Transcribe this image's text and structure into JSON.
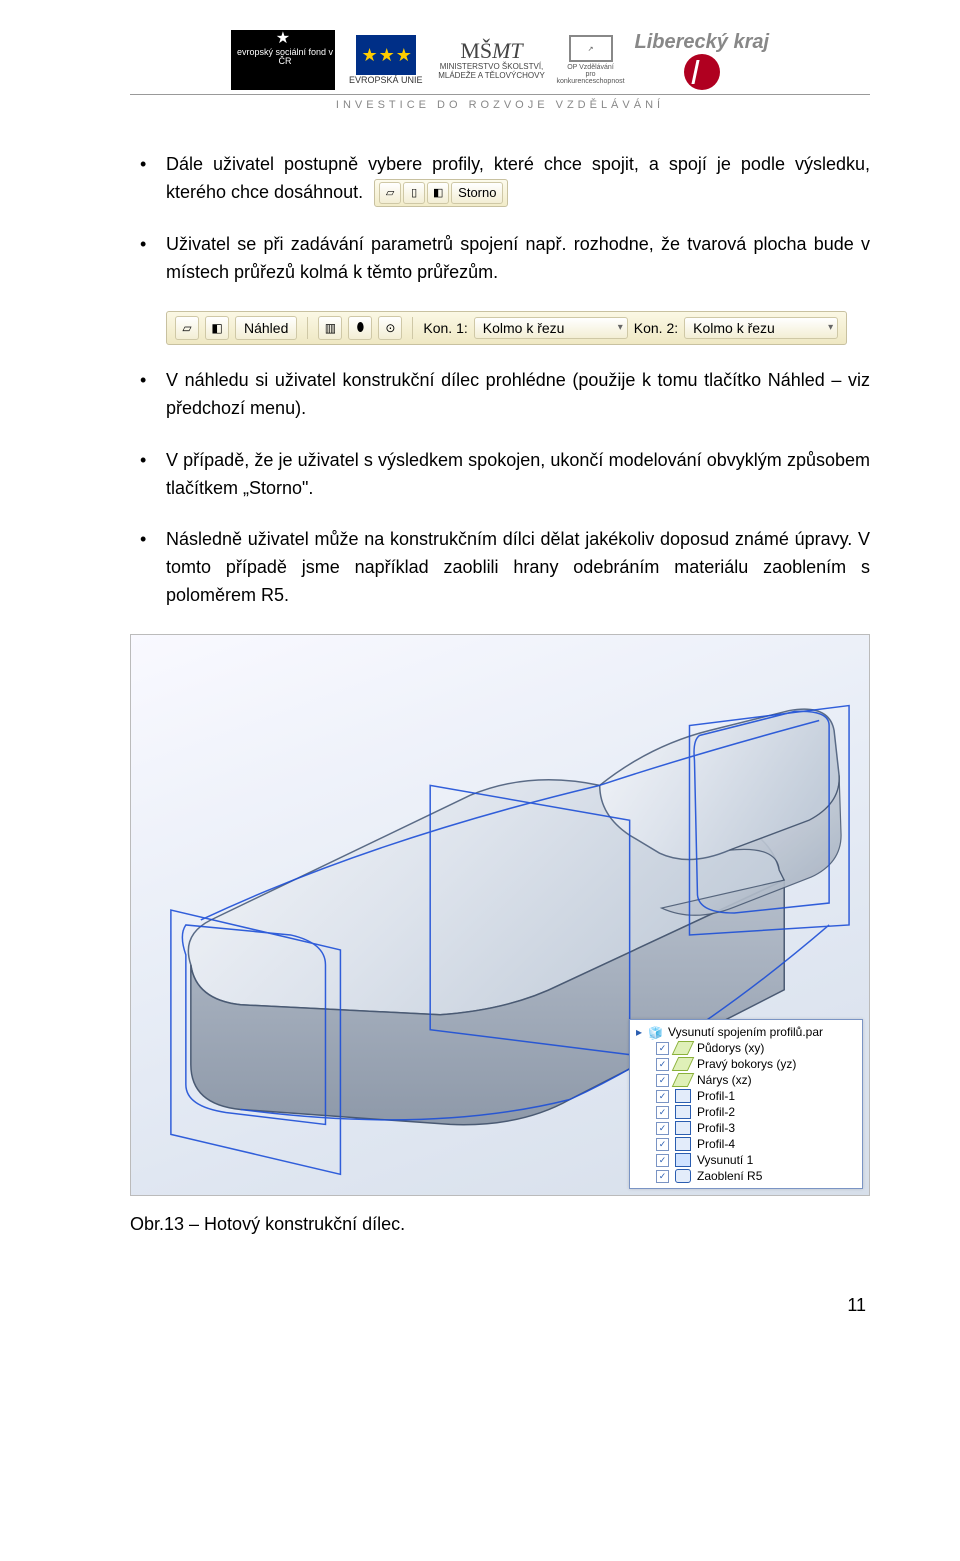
{
  "header": {
    "logos": {
      "esf": "evropský sociální fond v ČR",
      "eu": "EVROPSKÁ UNIE",
      "msmt_top": "MŠMT",
      "msmt_sub": "MINISTERSTVO ŠKOLSTVÍ, MLÁDEŽE A TĚLOVÝCHOVY",
      "op_top": "OP Vzdělávání",
      "op_sub": "pro konkurenceschopnost",
      "lk": "Liberecký kraj"
    },
    "tagline": "INVESTICE DO ROZVOJE VZDĚLÁVÁNÍ"
  },
  "bullets": {
    "b1a": "Dále uživatel postupně vybere profily, které chce spojit, a spojí je podle výsledku, kterého chce dosáhnout.",
    "b1_toolbar_storno": "Storno",
    "b2": "Uživatel se při zadávání parametrů spojení např. rozhodne, že tvarová plocha bude v místech průřezů kolmá k těmto průřezům.",
    "tb2": {
      "nahled": "Náhled",
      "kon1_label": "Kon. 1:",
      "kon1_val": "Kolmo k řezu",
      "kon2_label": "Kon. 2:",
      "kon2_val": "Kolmo k řezu"
    },
    "b3": "V náhledu si uživatel konstrukční dílec prohlédne (použije k tomu tlačítko Náhled – viz předchozí menu).",
    "b4": "V případě, že je uživatel s výsledkem spokojen, ukončí modelování obvyklým způsobem tlačítkem „Storno\".",
    "b5": "Následně uživatel může na konstrukčním dílci dělat jakékoliv doposud známé úpravy. V tomto případě jsme například zaoblili hrany odebráním materiálu zaoblením s poloměrem R5."
  },
  "tree": {
    "root": "Vysunutí spojením profilů.par",
    "items": [
      "Půdorys (xy)",
      "Pravý bokorys (yz)",
      "Nárys (xz)",
      "Profil-1",
      "Profil-2",
      "Profil-3",
      "Profil-4",
      "Vysunutí 1",
      "Zaoblení R5"
    ]
  },
  "caption": "Obr.13 – Hotový konstrukční dílec.",
  "page_number": "11"
}
